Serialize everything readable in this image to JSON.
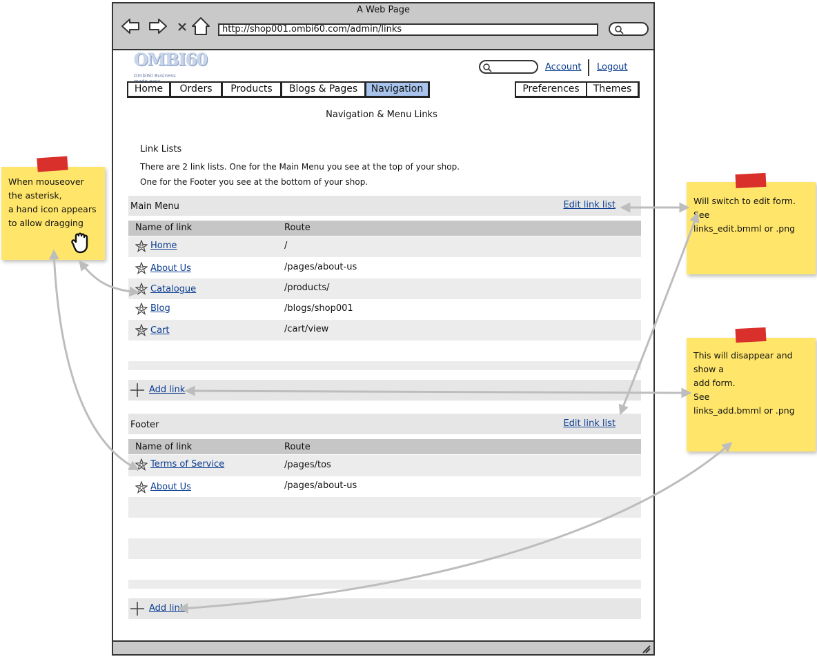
{
  "window": {
    "title": "A Web Page",
    "url": "http://shop001.ombi60.com/admin/links"
  },
  "header": {
    "logo_text": "OMBI60",
    "logo_tagline": "Ombi60 Business made easy",
    "account_label": "Account",
    "logout_label": "Logout"
  },
  "nav": {
    "tabs": [
      "Home",
      "Orders",
      "Products",
      "Blogs & Pages",
      "Navigation"
    ],
    "active": "Navigation",
    "right_tabs": [
      "Preferences",
      "Themes"
    ]
  },
  "page": {
    "heading": "Navigation & Menu Links",
    "intro_title": "Link Lists",
    "intro_lines": [
      "There are 2 link lists. One for the Main Menu you see at the top of your shop.",
      "One for the Footer you see at the bottom of your shop."
    ]
  },
  "sections": [
    {
      "title": "Main Menu",
      "edit_label": "Edit link list",
      "columns": [
        "Name of link",
        "Route"
      ],
      "links": [
        {
          "name": "Home",
          "route": "/"
        },
        {
          "name": "About Us",
          "route": "/pages/about-us"
        },
        {
          "name": "Catalogue",
          "route": "/products/"
        },
        {
          "name": "Blog",
          "route": "/blogs/shop001"
        },
        {
          "name": "Cart",
          "route": "/cart/view"
        }
      ],
      "add_label": "Add link"
    },
    {
      "title": "Footer",
      "edit_label": "Edit link list",
      "columns": [
        "Name of link",
        "Route"
      ],
      "links": [
        {
          "name": "Terms of Service",
          "route": "/pages/tos"
        },
        {
          "name": "About Us",
          "route": "/pages/about-us"
        }
      ],
      "add_label": "Add link"
    }
  ],
  "notes": {
    "drag": [
      "When mouseover",
      "the asterisk,",
      "a hand icon appears",
      "to allow dragging"
    ],
    "edit": [
      "Will switch to edit form.",
      "See",
      "links_edit.bmml or .png"
    ],
    "add": [
      "This will disappear and",
      "show a",
      "add form.",
      "See",
      "links_add.bmml or .png"
    ]
  },
  "colors": {
    "sticky": "#ffe66a",
    "tape": "#d9302c",
    "link": "#0b3d91",
    "active_tab": "#a8c4ec",
    "arrow": "#bdbdbd"
  }
}
